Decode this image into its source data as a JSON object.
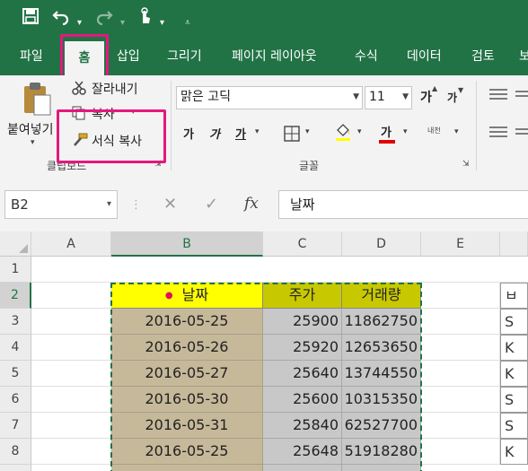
{
  "quick_access": {
    "save_icon": "save-icon",
    "undo_icon": "undo-icon",
    "redo_icon": "redo-icon",
    "touch_icon": "touch-mode-icon",
    "customize_icon": "customize-qat-icon"
  },
  "tabs": [
    {
      "label": "파일"
    },
    {
      "label": "홈"
    },
    {
      "label": "삽입"
    },
    {
      "label": "그리기"
    },
    {
      "label": "페이지 레이아웃"
    },
    {
      "label": "수식"
    },
    {
      "label": "데이터"
    },
    {
      "label": "검토"
    },
    {
      "label": "보"
    }
  ],
  "ribbon": {
    "clipboard": {
      "paste_label": "붙여넣기",
      "cut_label": "잘라내기",
      "copy_label": "복사",
      "format_painter_label": "서식 복사",
      "group_label": "클립보드"
    },
    "font": {
      "font_name": "맑은 고딕",
      "font_size": "11",
      "grow_font": "가",
      "shrink_font": "가",
      "bold": "가",
      "italic": "가",
      "underline": "가",
      "font_color": "가",
      "phonetic": "내천",
      "group_label": "글꼴"
    }
  },
  "formula_bar": {
    "name_box": "B2",
    "cancel_symbol": "✕",
    "enter_symbol": "✓",
    "fx_label": "fx",
    "content": "날짜"
  },
  "sheet": {
    "columns": [
      "A",
      "B",
      "C",
      "D",
      "E"
    ],
    "rows": [
      "1",
      "2",
      "3",
      "4",
      "5",
      "6",
      "7",
      "8"
    ],
    "header": {
      "date": "날짜",
      "price": "주가",
      "volume": "거래량"
    },
    "data": [
      {
        "date": "2016-05-25",
        "price": "25900",
        "volume": "11862750"
      },
      {
        "date": "2016-05-26",
        "price": "25920",
        "volume": "12653650"
      },
      {
        "date": "2016-05-27",
        "price": "25640",
        "volume": "13744550"
      },
      {
        "date": "2016-05-30",
        "price": "25600",
        "volume": "10315350"
      },
      {
        "date": "2016-05-31",
        "price": "25840",
        "volume": "62527700"
      },
      {
        "date": "2016-05-25",
        "price": "25648",
        "volume": "51918280"
      }
    ],
    "right_column": [
      "ㅂ",
      "S",
      "K",
      "K",
      "S",
      "S",
      "K"
    ]
  }
}
